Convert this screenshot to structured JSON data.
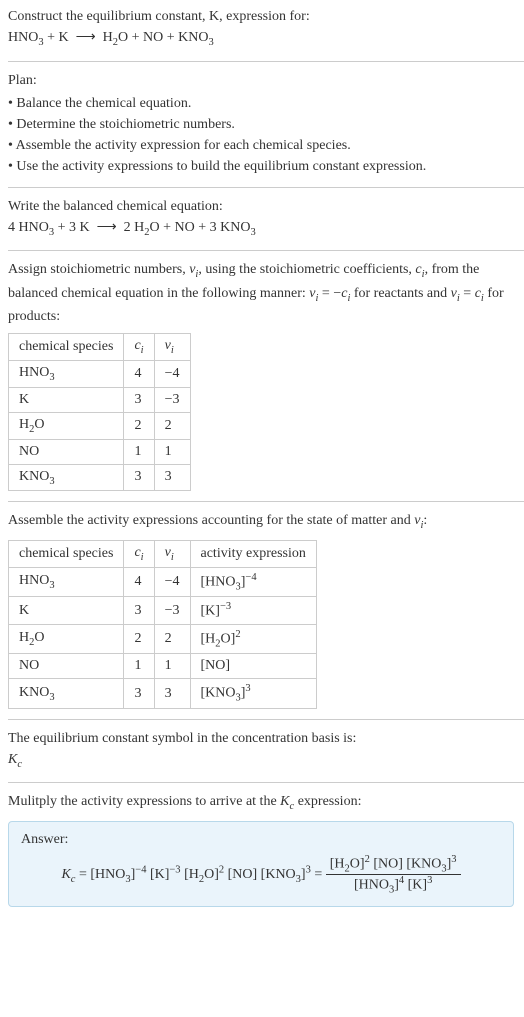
{
  "prompt": {
    "line1": "Construct the equilibrium constant, K, expression for:",
    "line2_html": "HNO<sub>3</sub> + K &nbsp;⟶&nbsp; H<sub>2</sub>O + NO + KNO<sub>3</sub>"
  },
  "plan": {
    "heading": "Plan:",
    "bullets": [
      "• Balance the chemical equation.",
      "• Determine the stoichiometric numbers.",
      "• Assemble the activity expression for each chemical species.",
      "• Use the activity expressions to build the equilibrium constant expression."
    ]
  },
  "balanced": {
    "heading": "Write the balanced chemical equation:",
    "eq_html": "4 HNO<sub>3</sub> + 3 K &nbsp;⟶&nbsp; 2 H<sub>2</sub>O + NO + 3 KNO<sub>3</sub>"
  },
  "stoich_intro_html": "Assign stoichiometric numbers, <i>ν<sub>i</sub></i>, using the stoichiometric coefficients, <i>c<sub>i</sub></i>, from the balanced chemical equation in the following manner: <i>ν<sub>i</sub></i> = −<i>c<sub>i</sub></i> for reactants and <i>ν<sub>i</sub></i> = <i>c<sub>i</sub></i> for products:",
  "table1": {
    "headers": {
      "species": "chemical species",
      "ci_html": "<i>c<sub>i</sub></i>",
      "vi_html": "<i>ν<sub>i</sub></i>"
    },
    "rows": [
      {
        "species_html": "HNO<sub>3</sub>",
        "ci": "4",
        "vi": "−4"
      },
      {
        "species_html": "K",
        "ci": "3",
        "vi": "−3"
      },
      {
        "species_html": "H<sub>2</sub>O",
        "ci": "2",
        "vi": "2"
      },
      {
        "species_html": "NO",
        "ci": "1",
        "vi": "1"
      },
      {
        "species_html": "KNO<sub>3</sub>",
        "ci": "3",
        "vi": "3"
      }
    ]
  },
  "activity_intro_html": "Assemble the activity expressions accounting for the state of matter and <i>ν<sub>i</sub></i>:",
  "table2": {
    "headers": {
      "species": "chemical species",
      "ci_html": "<i>c<sub>i</sub></i>",
      "vi_html": "<i>ν<sub>i</sub></i>",
      "activity": "activity expression"
    },
    "rows": [
      {
        "species_html": "HNO<sub>3</sub>",
        "ci": "4",
        "vi": "−4",
        "act_html": "[HNO<sub>3</sub>]<sup>−4</sup>"
      },
      {
        "species_html": "K",
        "ci": "3",
        "vi": "−3",
        "act_html": "[K]<sup>−3</sup>"
      },
      {
        "species_html": "H<sub>2</sub>O",
        "ci": "2",
        "vi": "2",
        "act_html": "[H<sub>2</sub>O]<sup>2</sup>"
      },
      {
        "species_html": "NO",
        "ci": "1",
        "vi": "1",
        "act_html": "[NO]"
      },
      {
        "species_html": "KNO<sub>3</sub>",
        "ci": "3",
        "vi": "3",
        "act_html": "[KNO<sub>3</sub>]<sup>3</sup>"
      }
    ]
  },
  "kc_symbol": {
    "text": "The equilibrium constant symbol in the concentration basis is:",
    "symbol_html": "<i>K<sub>c</sub></i>"
  },
  "multiply_intro_html": "Mulitply the activity expressions to arrive at the <i>K<sub>c</sub></i> expression:",
  "answer": {
    "label": "Answer:",
    "lhs_html": "<i>K<sub>c</sub></i> = [HNO<sub>3</sub>]<sup>−4</sup> [K]<sup>−3</sup> [H<sub>2</sub>O]<sup>2</sup> [NO] [KNO<sub>3</sub>]<sup>3</sup> = ",
    "num_html": "[H<sub>2</sub>O]<sup>2</sup> [NO] [KNO<sub>3</sub>]<sup>3</sup>",
    "den_html": "[HNO<sub>3</sub>]<sup>4</sup> [K]<sup>3</sup>"
  },
  "chart_data": {
    "type": "table",
    "title": "Stoichiometric numbers and activity expressions",
    "columns": [
      "chemical species",
      "c_i",
      "ν_i",
      "activity expression"
    ],
    "rows": [
      [
        "HNO3",
        4,
        -4,
        "[HNO3]^-4"
      ],
      [
        "K",
        3,
        -3,
        "[K]^-3"
      ],
      [
        "H2O",
        2,
        2,
        "[H2O]^2"
      ],
      [
        "NO",
        1,
        1,
        "[NO]"
      ],
      [
        "KNO3",
        3,
        3,
        "[KNO3]^3"
      ]
    ]
  }
}
